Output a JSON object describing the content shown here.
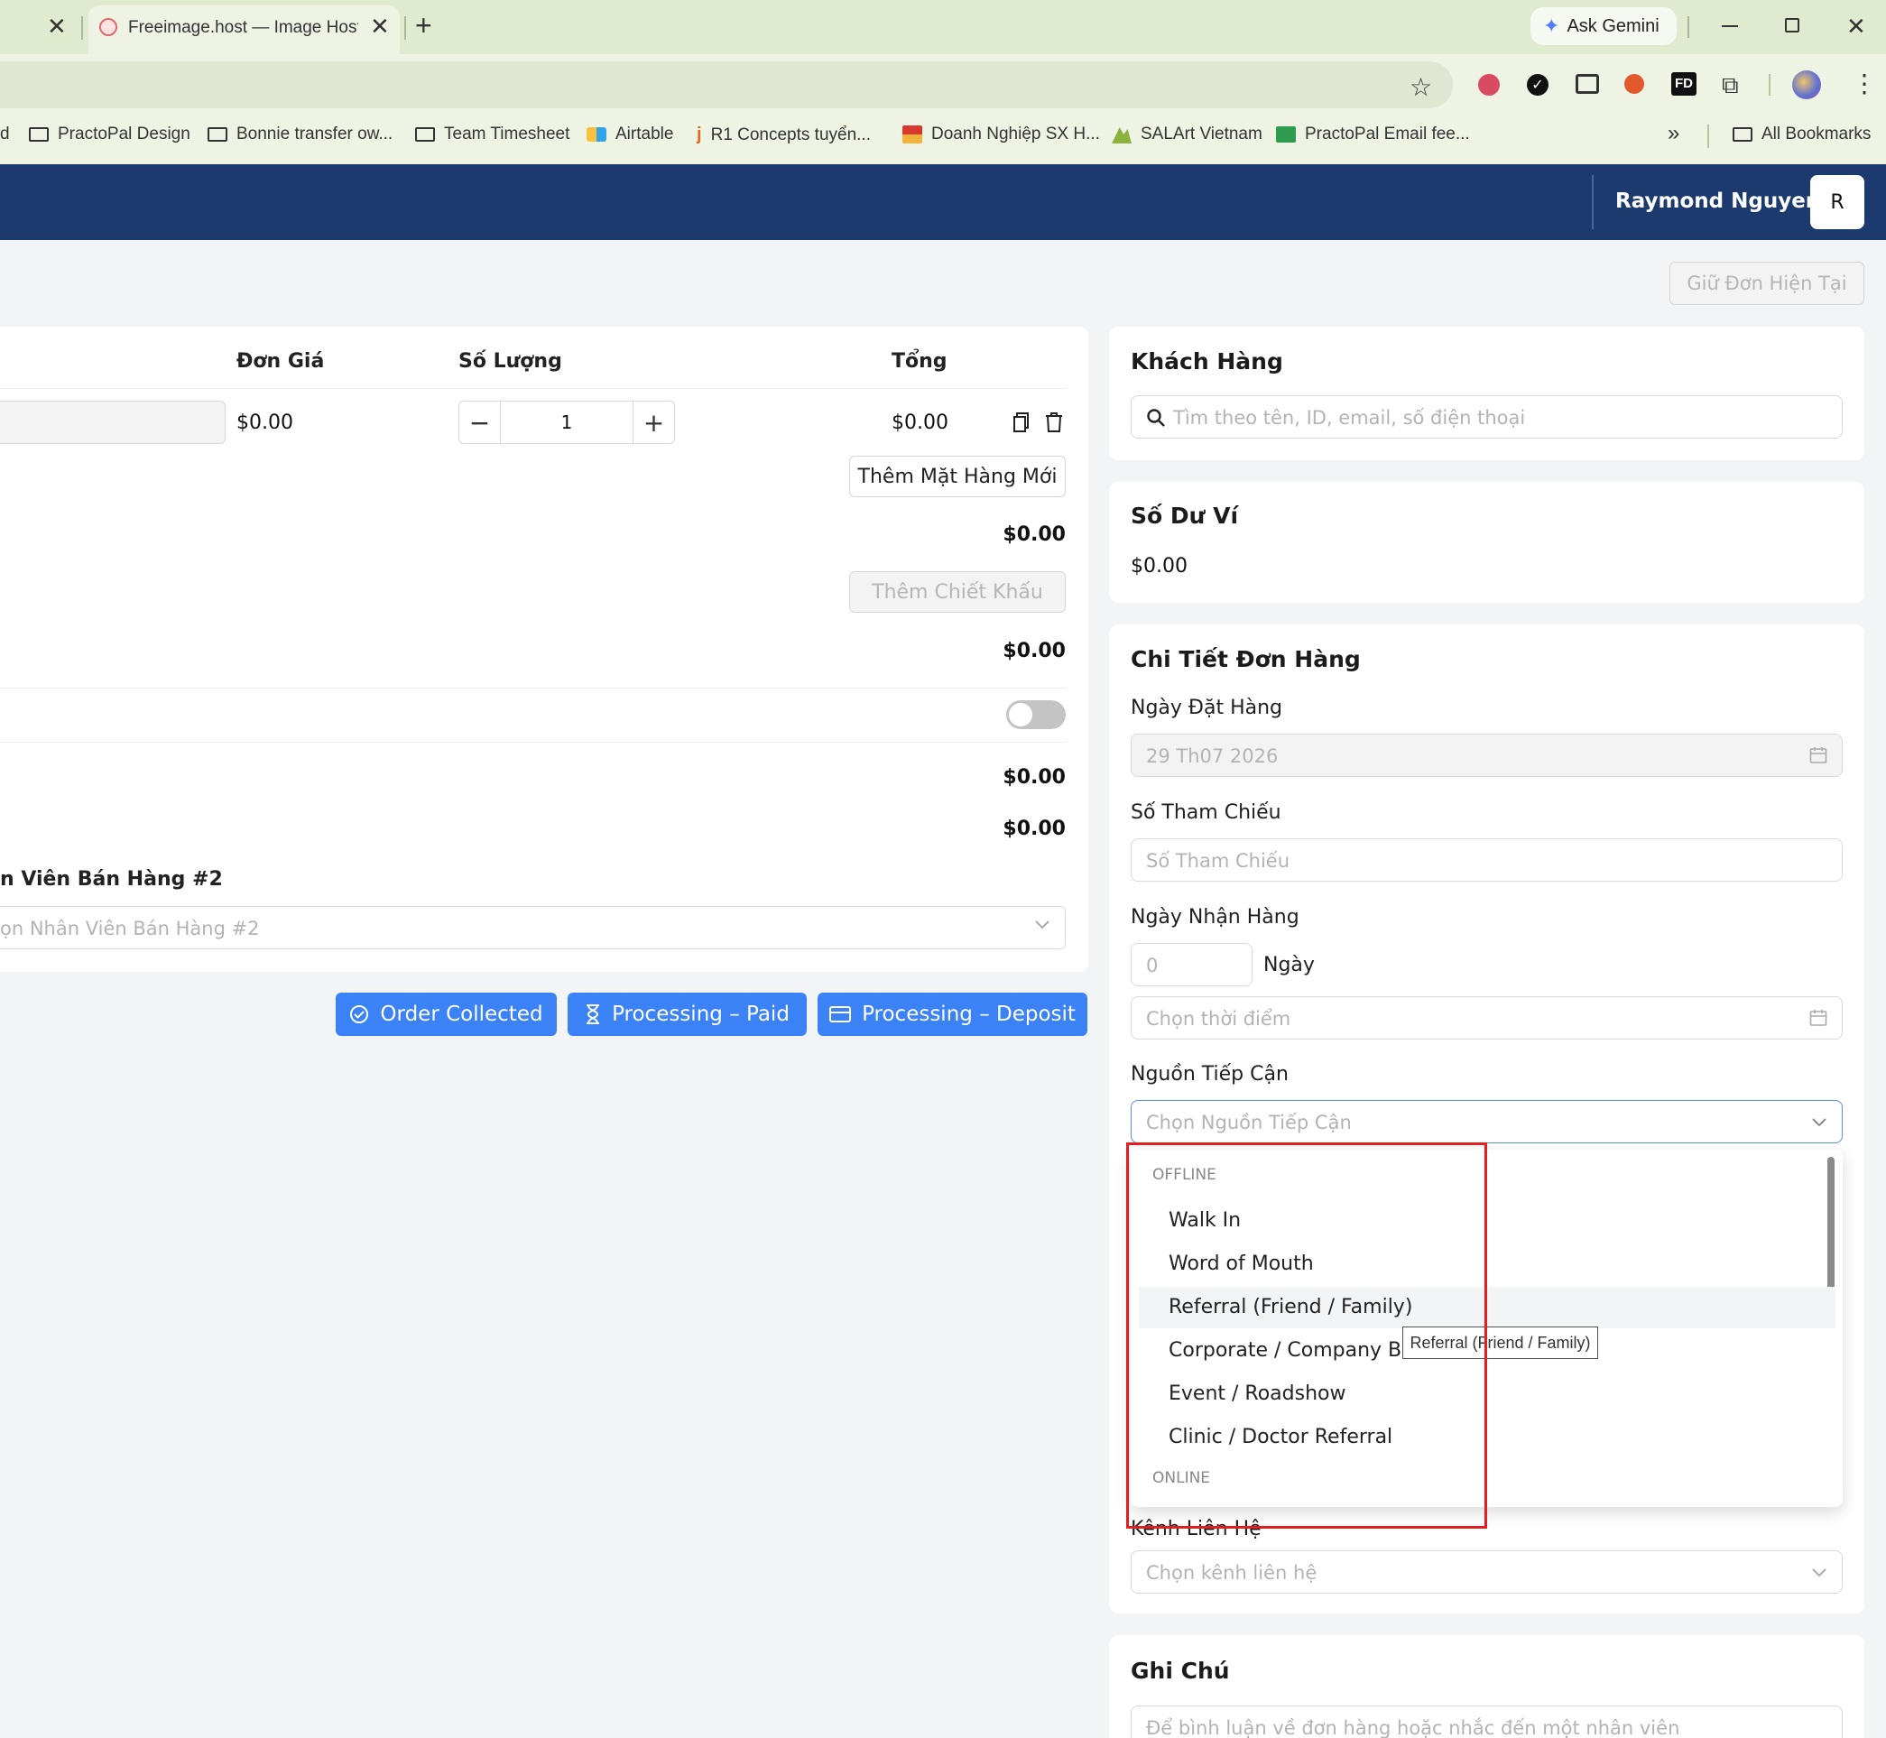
{
  "browser": {
    "tab_title": "Freeimage.host — Image Hostin",
    "ask_gemini": "Ask Gemini",
    "bookmarks": [
      "PractoPal Design",
      "Bonnie transfer ow...",
      "Team Timesheet",
      "Airtable",
      "R1 Concepts tuyển...",
      "Doanh Nghiệp SX H...",
      "SALArt Vietnam",
      "PractoPal Email fee..."
    ],
    "all_bookmarks": "All Bookmarks"
  },
  "header": {
    "user_name": "Raymond Nguyen",
    "avatar_initial": "R",
    "hold_order_button": "Giữ Đơn Hiện Tại"
  },
  "items": {
    "columns": {
      "price": "Đơn Giá",
      "quantity": "Số Lượng",
      "total": "Tổng"
    },
    "row": {
      "price": "$0.00",
      "quantity": "1",
      "total": "$0.00"
    },
    "add_item_button": "Thêm Mặt Hàng Mới",
    "subtotal": "$0.00",
    "add_discount_button": "Thêm Chiết Khấu",
    "discount_total": "$0.00",
    "total_1": "$0.00",
    "total_2": "$0.00",
    "sales_staff_2_label": "n Viên Bán Hàng #2",
    "sales_staff_2_placeholder": "ọn Nhân Viên Bán Hàng #2"
  },
  "actions": {
    "order_collected": "Order Collected",
    "processing_paid": "Processing – Paid",
    "processing_deposit": "Processing – Deposit"
  },
  "customer": {
    "title": "Khách Hàng",
    "search_placeholder": "Tìm theo tên, ID, email, số điện thoại"
  },
  "wallet": {
    "title": "Số Dư Ví",
    "balance": "$0.00"
  },
  "order_details": {
    "title": "Chi Tiết Đơn Hàng",
    "order_date_label": "Ngày Đặt Hàng",
    "order_date_value": "29 Th07 2026",
    "reference_label": "Số Tham Chiếu",
    "reference_placeholder": "Số Tham Chiếu",
    "receive_date_label": "Ngày Nhận Hàng",
    "days_placeholder": "0",
    "days_unit": "Ngày",
    "time_placeholder": "Chọn thời điểm",
    "source_label": "Nguồn Tiếp Cận",
    "source_placeholder": "Chọn Nguồn Tiếp Cận",
    "contact_channel_label": "Kênh Liên Hệ",
    "contact_channel_placeholder": "Chọn kênh liên hệ"
  },
  "dropdown": {
    "group_offline": "OFFLINE",
    "options": [
      "Walk In",
      "Word of Mouth",
      "Referral (Friend / Family)",
      "Corporate / Company Be",
      "Event / Roadshow",
      "Clinic / Doctor Referral"
    ],
    "group_online": "ONLINE",
    "tooltip": "Referral (Friend / Family)",
    "highlighted_index": 2
  },
  "notes": {
    "title": "Ghi Chú",
    "placeholder": "Để bình luận về đơn hàng hoặc nhắc đến một nhân viên"
  },
  "colors": {
    "header_bg": "#1c3a6e",
    "primary_button": "#3b82f6",
    "highlight_box": "#e02020",
    "tabbar_bg": "#dfeacf"
  }
}
